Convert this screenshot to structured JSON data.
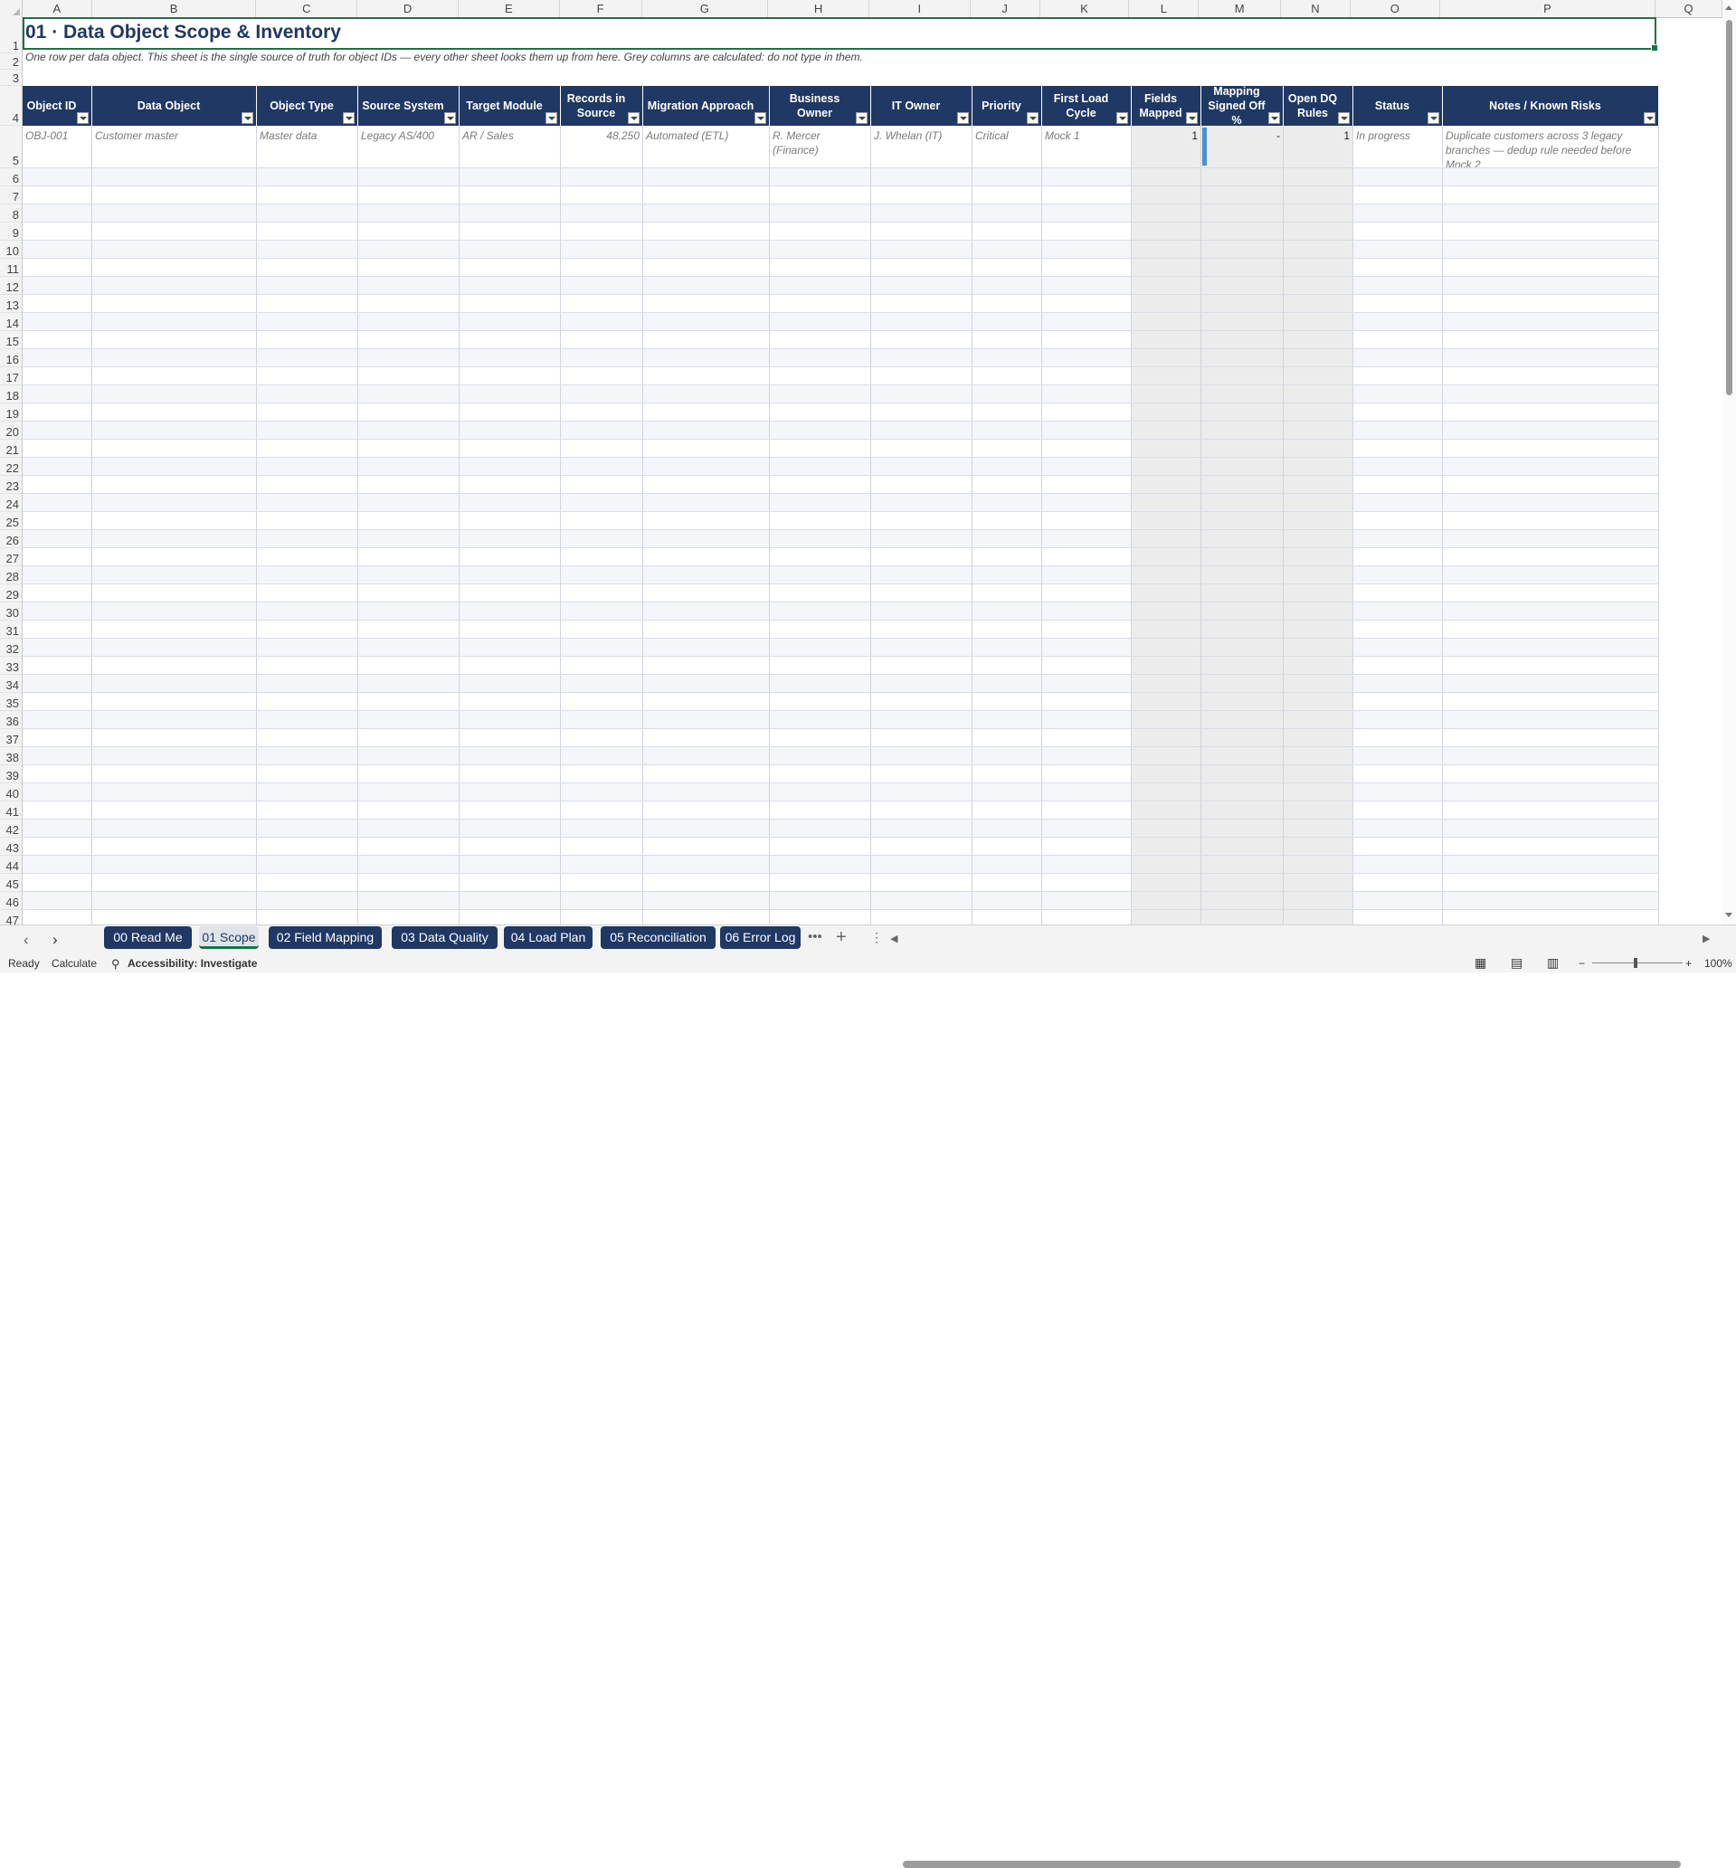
{
  "columns": [
    "A",
    "B",
    "C",
    "D",
    "E",
    "F",
    "G",
    "H",
    "I",
    "J",
    "K",
    "L",
    "M",
    "N",
    "O",
    "P",
    "Q"
  ],
  "row_numbers": [
    "1",
    "2",
    "3",
    "4",
    "5",
    "6",
    "7",
    "8",
    "9",
    "10",
    "11",
    "12",
    "13",
    "14",
    "15",
    "16",
    "17",
    "18",
    "19",
    "20",
    "21",
    "22",
    "23",
    "24",
    "25",
    "26",
    "27",
    "28",
    "29",
    "30",
    "31",
    "32",
    "33",
    "34",
    "35",
    "36",
    "37",
    "38",
    "39",
    "40",
    "41",
    "42",
    "43",
    "44",
    "45",
    "46",
    "47"
  ],
  "title": "01 · Data Object Scope & Inventory",
  "subtitle": "One row per data object. This sheet is the single source of truth for object IDs — every other sheet looks them up from here. Grey columns are calculated: do not type in them.",
  "headers": [
    "Object ID",
    "Data Object",
    "Object Type",
    "Source System",
    "Target Module",
    "Records in Source",
    "Migration Approach",
    "Business Owner",
    "IT Owner",
    "Priority",
    "First Load Cycle",
    "Fields Mapped",
    "Mapping Signed Off %",
    "Open DQ Rules",
    "Status",
    "Notes / Known Risks"
  ],
  "first_row": [
    "OBJ-001",
    "Customer master",
    "Master data",
    "Legacy AS/400",
    "AR / Sales",
    "48,250",
    "Automated (ETL)",
    "R. Mercer (Finance)",
    "J. Whelan (IT)",
    "Critical",
    "Mock 1",
    "1",
    "-",
    "1",
    "In progress",
    "Duplicate customers across 3 legacy branches — dedup rule needed before Mock 2"
  ],
  "tabs": [
    "00 Read Me",
    "01 Scope",
    "02 Field Mapping",
    "03 Data Quality",
    "04 Load Plan",
    "05 Reconciliation",
    "06 Error Log"
  ],
  "status": {
    "ready": "Ready",
    "calculate": "Calculate",
    "accessibility": "Accessibility: Investigate",
    "zoom": "100%"
  },
  "colors": {
    "header_navy": "#1f3864",
    "selection_green": "#1e7145",
    "calc_grey": "#ececec"
  }
}
